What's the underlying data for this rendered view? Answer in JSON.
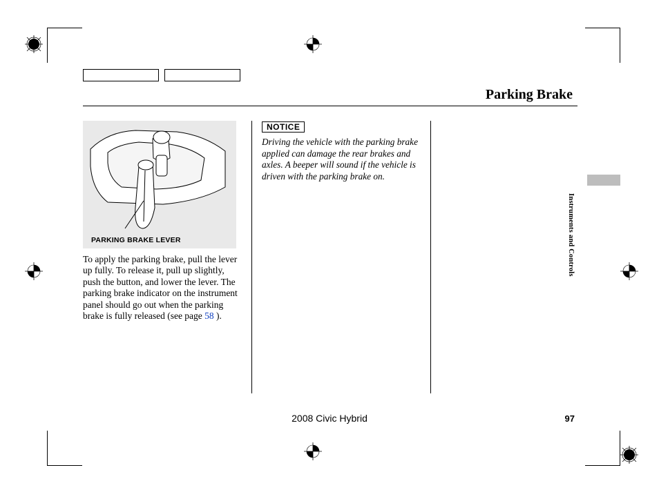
{
  "title": "Parking Brake",
  "figure_caption": "PARKING BRAKE LEVER",
  "body_text": "To apply the parking brake, pull the lever up fully. To release it, pull up slightly, push the button, and lower the lever. The parking brake indicator on the instrument panel should go out when the parking brake is fully released (see page ",
  "page_ref": "58",
  "body_text_tail": " ).",
  "notice_label": "NOTICE",
  "notice_text": "Driving the vehicle with the parking brake applied can damage the rear brakes and axles. A beeper will sound if the vehicle is driven with the parking brake on.",
  "side_label": "Instruments and Controls",
  "footer_model": "2008 Civic Hybrid",
  "footer_page": "97"
}
